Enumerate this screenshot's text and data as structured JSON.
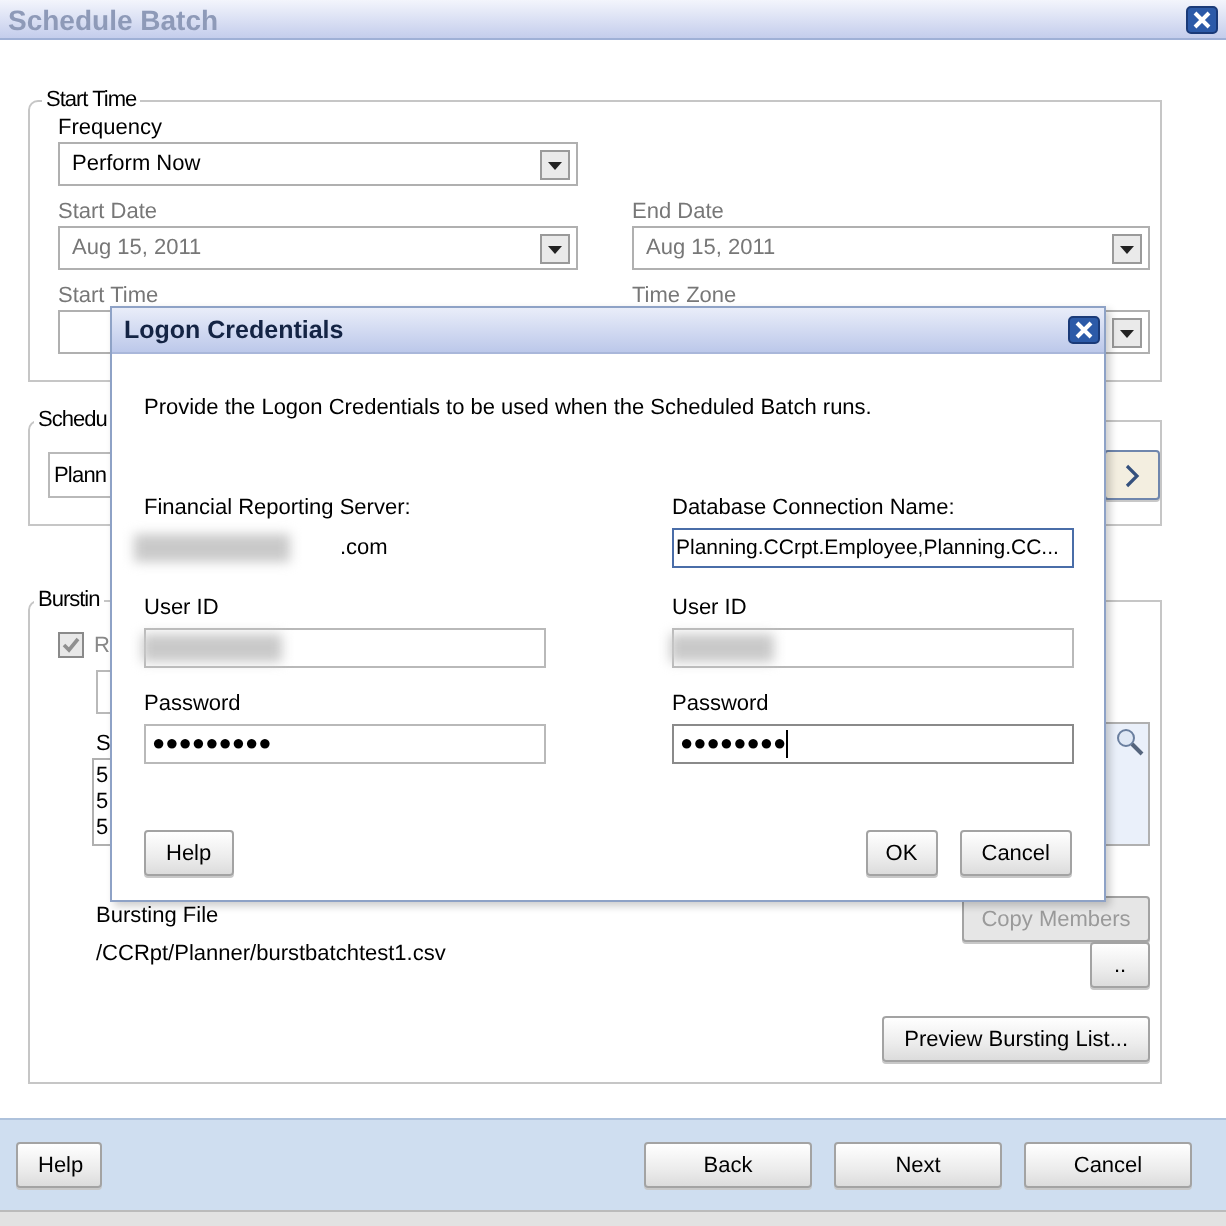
{
  "window": {
    "title": "Schedule Batch"
  },
  "start_time": {
    "legend": "Start Time",
    "frequency": {
      "label": "Frequency",
      "value": "Perform Now",
      "disabled": false
    },
    "start_date": {
      "label": "Start Date",
      "value": "Aug 15, 2011",
      "disabled": true
    },
    "end_date": {
      "label": "End Date",
      "value": "Aug 15, 2011",
      "disabled": true
    },
    "start_time_label": "Start Time",
    "time_zone_label": "Time Zone"
  },
  "schedule": {
    "legend": "Schedu",
    "field_value": "Plann"
  },
  "bursting": {
    "legend": "Burstin",
    "checkbox": {
      "label": "R",
      "checked": true,
      "disabled": true
    },
    "list_label": "S",
    "list_items": [
      "5",
      "5",
      "5"
    ],
    "file_label": "Bursting File",
    "file_path": "/CCRpt/Planner/burstbatchtest1.csv",
    "copy_members": {
      "label": "Copy Members",
      "disabled": true
    },
    "browse_button": "..",
    "preview_button": "Preview Bursting List..."
  },
  "footer_buttons": [
    {
      "label": "Help",
      "kind": "help"
    },
    {
      "label": "Back",
      "kind": "nav"
    },
    {
      "label": "Next",
      "kind": "nav"
    },
    {
      "label": "Cancel",
      "kind": "nav"
    }
  ],
  "logon_dialog": {
    "title": "Logon Credentials",
    "instruction": "Provide the Logon Credentials to be used when the Scheduled Batch runs.",
    "columns": [
      {
        "kind": "server",
        "heading": "Financial Reporting Server:",
        "value": ".com",
        "user_id_label": "User ID",
        "password_label": "Password",
        "password": "●●●●●●●●●",
        "focused": false
      },
      {
        "kind": "connection",
        "heading": "Database Connection Name:",
        "value": "Planning.CCrpt.Employee,Planning.CC...",
        "user_id_label": "User ID",
        "password_label": "Password",
        "password": "●●●●●●●●",
        "focused": true
      }
    ],
    "buttons": [
      {
        "label": "Help",
        "kind": "left"
      },
      {
        "label": "OK",
        "kind": "right"
      },
      {
        "label": "Cancel",
        "kind": "right"
      }
    ]
  }
}
